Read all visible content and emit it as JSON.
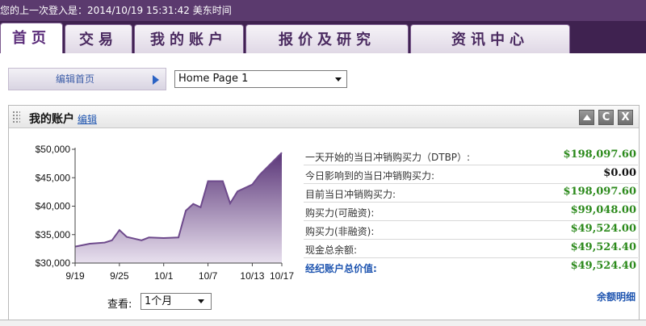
{
  "topbar": {
    "last_login": "您的上一次登入是：2014/10/19 15:31:42 美东时间"
  },
  "tabs": [
    {
      "label": "首页",
      "active": true
    },
    {
      "label": "交易",
      "active": false
    },
    {
      "label": "我的账户",
      "active": false
    },
    {
      "label": "报价及研究",
      "active": false
    },
    {
      "label": "资讯中心",
      "active": false
    }
  ],
  "edit_row": {
    "edit_home_label": "编辑首页",
    "page_select_value": "Home Page 1"
  },
  "panel": {
    "title": "我的账户",
    "edit_link": "编辑",
    "controls": {
      "refresh": "C",
      "close": "X"
    },
    "view_label": "查看:",
    "view_value": "1个月",
    "balance_detail_link": "余额明细"
  },
  "metrics": [
    {
      "label": "一天开始的当日冲销购买力（DTBP）:",
      "value": "$198,097.60"
    },
    {
      "label": "今日影响到的当日冲销购买力:",
      "value": "$0.00"
    },
    {
      "label": "目前当日冲销购买力:",
      "value": "$198,097.60"
    },
    {
      "label": "购买力(可融资):",
      "value": "$99,048.00"
    },
    {
      "label": "购买力(非融资):",
      "value": "$49,524.00"
    },
    {
      "label": "现金总余额:",
      "value": "$49,524.40"
    },
    {
      "label": "经纪账户总价值:",
      "value": "$49,524.40"
    }
  ],
  "colors": {
    "brand_purple": "#3f2250",
    "value_green": "#2c8a1c",
    "link_blue": "#1f55b0"
  },
  "chart_data": {
    "type": "area",
    "x_ticks": [
      "9/19",
      "9/25",
      "10/1",
      "10/7",
      "10/13",
      "10/17"
    ],
    "y_ticks": [
      "$50,000",
      "$45,000",
      "$40,000",
      "$35,000",
      "$30,000"
    ],
    "ylim": [
      30000,
      50000
    ],
    "points": [
      [
        "9/19",
        32900
      ],
      [
        "9/21",
        33400
      ],
      [
        "9/23",
        33600
      ],
      [
        "9/24",
        34000
      ],
      [
        "9/25",
        35800
      ],
      [
        "9/26",
        34600
      ],
      [
        "9/28",
        34000
      ],
      [
        "9/29",
        34500
      ],
      [
        "10/1",
        34400
      ],
      [
        "10/3",
        34500
      ],
      [
        "10/4",
        39200
      ],
      [
        "10/5",
        40400
      ],
      [
        "10/6",
        39800
      ],
      [
        "10/7",
        44400
      ],
      [
        "10/9",
        44400
      ],
      [
        "10/10",
        40500
      ],
      [
        "10/11",
        42600
      ],
      [
        "10/13",
        43800
      ],
      [
        "10/14",
        45500
      ],
      [
        "10/15",
        46800
      ],
      [
        "10/17",
        49400
      ]
    ],
    "grid": false,
    "fill": "#6e4a8c"
  }
}
